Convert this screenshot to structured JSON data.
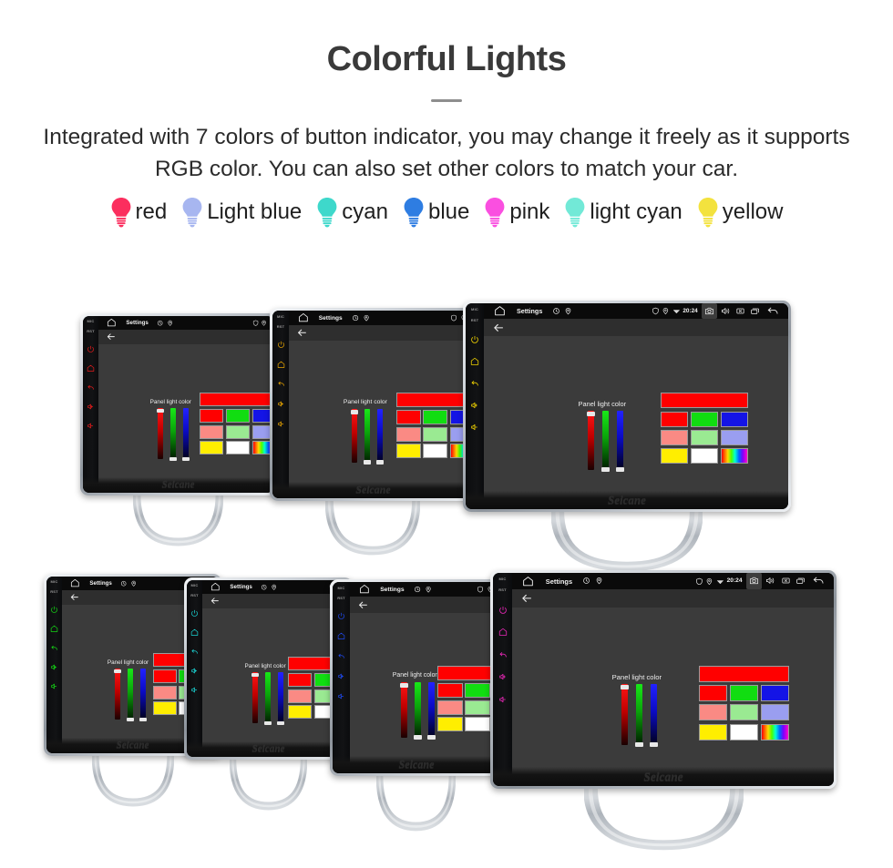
{
  "header": {
    "title": "Colorful Lights",
    "description": "Integrated with 7 colors of button indicator, you may change it freely as it supports RGB color. You can also set other colors to match your car."
  },
  "legend": {
    "items": [
      {
        "label": "red",
        "color": "#FB2E5E",
        "icon": "bulb-icon"
      },
      {
        "label": "Light blue",
        "color": "#A7B6F0",
        "icon": "bulb-icon"
      },
      {
        "label": "cyan",
        "color": "#3ED8CB",
        "icon": "bulb-icon"
      },
      {
        "label": "blue",
        "color": "#2E7DE2",
        "icon": "bulb-icon"
      },
      {
        "label": "pink",
        "color": "#FA4FE0",
        "icon": "bulb-icon"
      },
      {
        "label": "light cyan",
        "color": "#72E9D7",
        "icon": "bulb-icon"
      },
      {
        "label": "yellow",
        "color": "#F3E23E",
        "icon": "bulb-icon"
      }
    ]
  },
  "device_ui": {
    "statusbar": {
      "home_icon": "home-icon",
      "title": "Settings",
      "clock_icon": "clock-icon",
      "location_icon": "location-pin-icon",
      "right_icons": [
        "shield-icon",
        "location-pin-icon",
        "wifi-icon"
      ],
      "time": "20:24",
      "camera_icon": "camera-icon",
      "volume_icon": "speaker-icon",
      "close_icon": "x-box-icon",
      "recents_icon": "recent-apps-icon",
      "back_icon": "back-arrow-icon"
    },
    "actionbar": {
      "back_icon": "back-arrow-icon"
    },
    "panel": {
      "label": "Panel light color",
      "sliders": [
        {
          "name": "red-slider",
          "value": 100
        },
        {
          "name": "green-slider",
          "value": 0
        },
        {
          "name": "blue-slider",
          "value": 0
        }
      ],
      "preview_color": "#ff0000",
      "swatches": [
        [
          "#ff0000",
          "#11dd11",
          "#1414e6"
        ],
        [
          "#fa8a84",
          "#9aea92",
          "#9a9ef0"
        ],
        [
          "#ffee00",
          "#ffffff",
          "rainbow"
        ]
      ]
    },
    "brand": "Seicane",
    "bezel": {
      "mic_label": "MIC",
      "rst_label": "RST",
      "buttons": [
        "power-icon",
        "home-icon",
        "back-icon",
        "volume-up-icon",
        "volume-down-icon"
      ]
    }
  },
  "units": [
    {
      "name": "unit-red",
      "led_color": "#e51b1b",
      "row": 1,
      "index": 1,
      "full_ui": false
    },
    {
      "name": "unit-orange",
      "led_color": "#e8a400",
      "row": 1,
      "index": 2,
      "full_ui": false
    },
    {
      "name": "unit-yellow",
      "led_color": "#f2d400",
      "row": 1,
      "index": 3,
      "full_ui": true
    },
    {
      "name": "unit-green",
      "led_color": "#14d814",
      "row": 2,
      "index": 1,
      "full_ui": false
    },
    {
      "name": "unit-cyan",
      "led_color": "#1ad6d6",
      "row": 2,
      "index": 2,
      "full_ui": false
    },
    {
      "name": "unit-blue",
      "led_color": "#1f49ef",
      "row": 2,
      "index": 3,
      "full_ui": false
    },
    {
      "name": "unit-pink",
      "led_color": "#ee28bb",
      "row": 2,
      "index": 4,
      "full_ui": true
    }
  ]
}
